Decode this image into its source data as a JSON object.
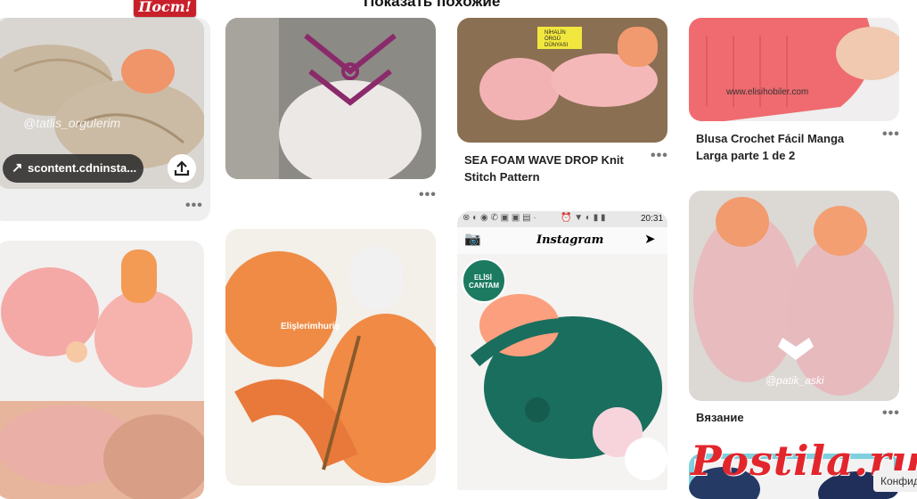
{
  "header": {
    "title": "Показать похожие",
    "logo_text": "Пост!"
  },
  "pins": [
    {
      "id": "pin-1",
      "image": "crochet-slipper-photo",
      "watermark": "@tatlis_orgulerim",
      "source_chip": "scontent.cdninsta..."
    },
    {
      "id": "pin-2",
      "image": "purple-crochet-socks-photo"
    },
    {
      "id": "pin-3",
      "image": "pink-crochet-slippers-photo",
      "title": "SEA FOAM WAVE DROP Knit Stitch Pattern",
      "badge": "NİHALİN ÖRGÜ DÜNYASI"
    },
    {
      "id": "pin-4",
      "image": "red-crochet-photo",
      "watermark": "www.elisihobiler.com",
      "title": "Blusa Crochet Fácil Manga Larga parte 1 de 2"
    },
    {
      "id": "pin-5",
      "image": "pink-lace-slippers-photo"
    },
    {
      "id": "pin-6",
      "image": "orange-crochet-slipper-photo",
      "watermark": "Elişlerimhuriş"
    },
    {
      "id": "pin-7",
      "image": "green-sandals-instagram-screenshot",
      "phone_time": "20:31",
      "app_title": "Instagram",
      "badge": "ELİSİ CANTAM"
    },
    {
      "id": "pin-8",
      "image": "pink-braided-slippers-photo",
      "watermark": "@patik_aski",
      "title": "Вязание"
    },
    {
      "id": "pin-9",
      "image": "navy-crochet-photo"
    }
  ],
  "more_label": "•••",
  "site_watermark": "Postila.ru",
  "cookie_label": "Конфид"
}
